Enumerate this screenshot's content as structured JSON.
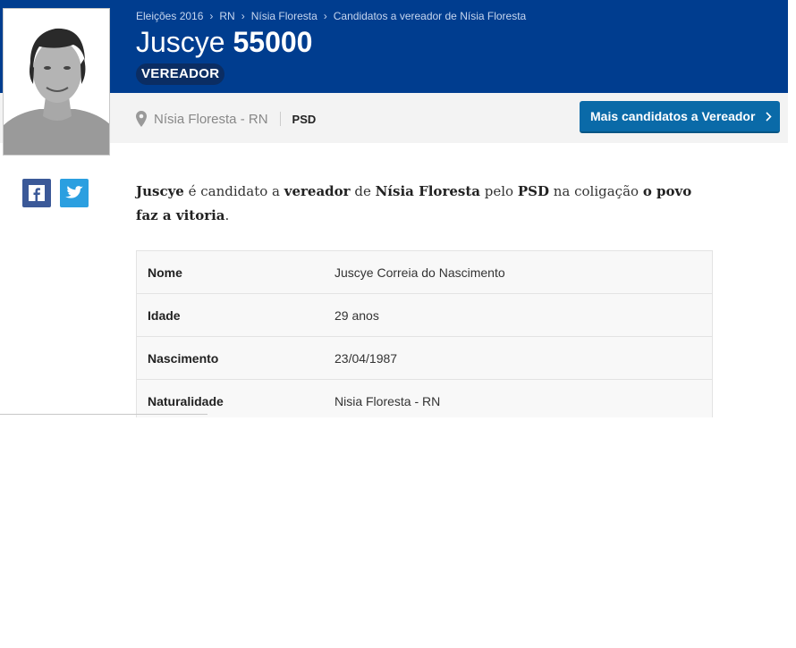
{
  "breadcrumb": [
    "Eleições 2016",
    "RN",
    "Nísia Floresta",
    "Candidatos a vereador de Nísia Floresta"
  ],
  "candidate": {
    "name": "Juscye",
    "number": "55000",
    "role": "VEREADOR",
    "location": "Nísia Floresta - RN",
    "party": "PSD"
  },
  "more_button": {
    "label": "Mais candidatos a Vereador"
  },
  "summary": {
    "name": "Juscye",
    "t1": " é candidato a ",
    "role": "vereador",
    "t2": " de ",
    "city": "Nísia Floresta",
    "t3": " pelo ",
    "party": "PSD",
    "t4": " na coligação ",
    "coalition": "o povo faz a vitoria",
    "t5": "."
  },
  "details": [
    {
      "label": "Nome",
      "value": "Juscye Correia do Nascimento"
    },
    {
      "label": "Idade",
      "value": "29 anos"
    },
    {
      "label": "Nascimento",
      "value": "23/04/1987"
    },
    {
      "label": "Naturalidade",
      "value": "Nisia Floresta - RN"
    }
  ],
  "icons": {
    "location": "map-pin-icon",
    "facebook": "facebook-icon",
    "twitter": "twitter-icon",
    "chevron": "chevron-right-icon"
  },
  "colors": {
    "header": "#003d8f",
    "button": "#0a6aa8",
    "facebook": "#3b5998",
    "twitter": "#2b9fe0"
  }
}
